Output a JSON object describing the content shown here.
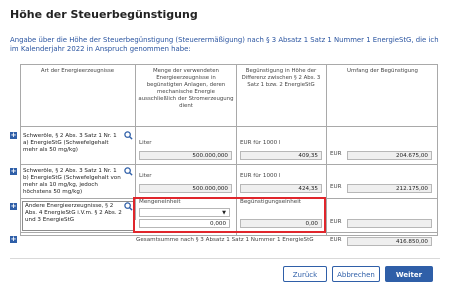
{
  "page": {
    "title": "Höhe der Steuerbegünstigung",
    "description": "Angabe über die Höhe der Steuerbegünstigung (Steuerermäßigung) nach § 3 Absatz 1 Satz 1 Nummer 1 EnergieStG, die ich im Kalenderjahr 2022 in Anspruch genommen habe:"
  },
  "table": {
    "headers": {
      "col1": "Art der Energieerzeugnisse",
      "col2": "Menge der verwendeten Energieerzeugnisse in begünstigten Anlagen, deren mechanische Energie ausschließlich der Stromerzeugung dient",
      "col3": "Begünstigung in Höhe der Differenz zwischen § 2 Abs. 3 Satz 1 bzw. 2 EnergieStG",
      "col4": "Umfang der Begünstigung"
    },
    "rows": [
      {
        "label": "Schweröle, § 2 Abs. 3 Satz 1 Nr. 1 a) EnergieStG (Schwefelgehalt mehr als 50 mg/kg)",
        "unit_label": "Liter",
        "quantity": "500.000,000",
        "rate_label": "EUR für 1000 l",
        "rate": "409,35",
        "currency": "EUR",
        "amount": "204.675,00"
      },
      {
        "label": "Schweröle, § 2 Abs. 3 Satz 1 Nr. 1 b) EnergieStG (Schwefelgehalt von mehr als 10 mg/kg, jedoch höchstens 50 mg/kg)",
        "unit_label": "Liter",
        "quantity": "500.000,000",
        "rate_label": "EUR für 1000 l",
        "rate": "424,35",
        "currency": "EUR",
        "amount": "212.175,00"
      },
      {
        "label": "Andere Energieerzeugnisse, § 2 Abs. 4 EnergieStG i.V.m. § 2 Abs. 2 und 3 EnergieStG",
        "unit_label": "Mengeneinheit",
        "unit_select": "",
        "quantity": "0,000",
        "rate_label": "Begünstigungseinheit",
        "rate": "0,00",
        "currency": "EUR",
        "amount": ""
      }
    ],
    "total": {
      "label": "Gesamtsumme nach § 3 Absatz 1 Satz 1 Nummer 1 EnergieStG",
      "currency": "EUR",
      "amount": "416.850,00"
    }
  },
  "buttons": {
    "back": "Zurück",
    "cancel": "Abbrechen",
    "next": "Weiter"
  },
  "icons": {
    "add": "plus-icon",
    "search": "search-icon"
  },
  "colors": {
    "accent": "#2f5fa8",
    "highlight": "#e0262c"
  }
}
